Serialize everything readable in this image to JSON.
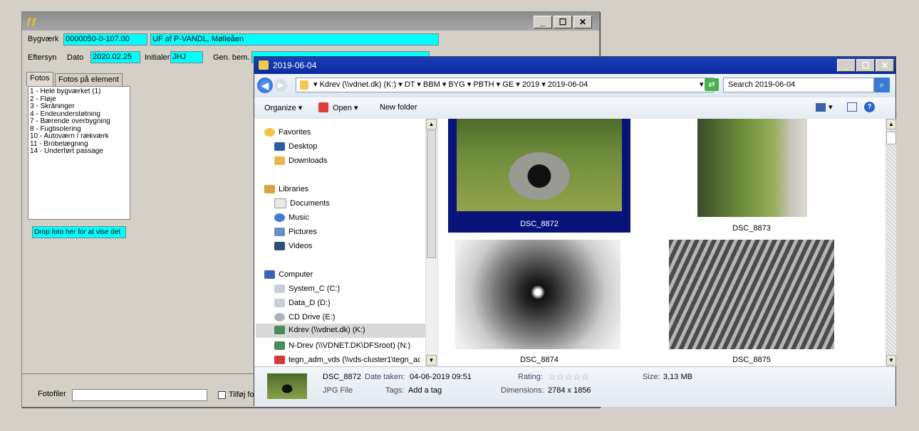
{
  "back_window": {
    "title_icon": "app-icon",
    "buttons": {
      "minimize": "_",
      "maximize": "☐",
      "close": "✕"
    },
    "bygvaerk_label": "Bygværk",
    "bygvaerk_value": "0000050-0-107.00",
    "bygvaerk_name": "UF af P-VANDL, Mølleåen",
    "eftersyn_label": "Eftersyn",
    "dato_label": "Dato",
    "dato_value": "2020.02.25",
    "initialer_label": "Initialer",
    "initialer_value": "JHJ",
    "genbem_label": "Gen. bem.",
    "tabs": [
      "Fotos",
      "Fotos på element"
    ],
    "list_items": [
      "1 - Hele bygværket (1)",
      "2 - Fløje",
      "3 - Skråninger",
      "4 - Endeunderstøtning",
      "7 - Bærende overbygning",
      "8 - Fugtisolering",
      "10 - Autoværn / rækværk",
      "11 - Brobelægning",
      "14 - Underført passage"
    ],
    "drop_text": "Drop foto her for at vise det",
    "fotofiler_label": "Fotofiler",
    "tilfoj_label": "Tilføj fo"
  },
  "explorer": {
    "title": "2019-06-04",
    "buttons": {
      "minimize": "_",
      "maximize": "☐",
      "close": "✕"
    },
    "breadcrumb": [
      "Kdrev (\\\\vdnet.dk) (K:)",
      "DT",
      "BBM",
      "BYG",
      "PBTH",
      "GE",
      "2019",
      "2019-06-04"
    ],
    "search_placeholder": "Search 2019-06-04",
    "toolbar": {
      "organize": "Organize",
      "open": "Open",
      "new_folder": "New folder"
    },
    "nav": {
      "favorites": "Favorites",
      "desktop": "Desktop",
      "downloads": "Downloads",
      "libraries": "Libraries",
      "documents": "Documents",
      "music": "Music",
      "pictures": "Pictures",
      "videos": "Videos",
      "computer": "Computer",
      "system_c": "System_C (C:)",
      "data_d": "Data_D (D:)",
      "cd_drive": "CD Drive (E:)",
      "kdrev": "Kdrev (\\\\vdnet.dk) (K:)",
      "ndrev": "N-Drev (\\\\VDNET.DK\\DFSroot) (N:)",
      "tegn": "tegn_adm_vds (\\\\vds-cluster1\\tegn_ad"
    },
    "files": [
      "DSC_8872",
      "DSC_8873",
      "DSC_8874",
      "DSC_8875"
    ],
    "details": {
      "name": "DSC_8872",
      "date_label": "Date taken:",
      "date_value": "04-06-2019 09:51",
      "type": "JPG File",
      "tags_label": "Tags:",
      "tags_value": "Add a tag",
      "rating_label": "Rating:",
      "rating_stars": "☆☆☆☆☆",
      "dimensions_label": "Dimensions:",
      "dimensions_value": "2784 x 1856",
      "size_label": "Size:",
      "size_value": "3,13 MB"
    }
  }
}
